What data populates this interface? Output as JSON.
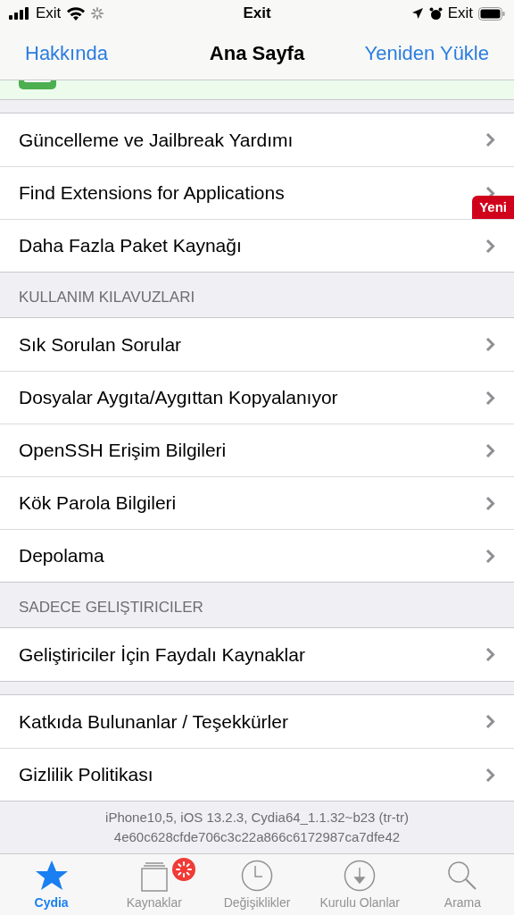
{
  "status_bar": {
    "left_carrier": "Exit",
    "center": "Exit",
    "right_carrier": "Exit"
  },
  "nav_bar": {
    "left_button": "Hakkında",
    "title": "Ana Sayfa",
    "right_button": "Yeniden Yükle"
  },
  "sections": [
    {
      "rows": [
        {
          "label": "Güncelleme ve Jailbreak Yardımı"
        },
        {
          "label": "Find Extensions for Applications",
          "badge": "Yeni"
        },
        {
          "label": "Daha Fazla Paket Kaynağı"
        }
      ]
    },
    {
      "header": "KULLANIM KILAVUZLARI",
      "rows": [
        {
          "label": "Sık Sorulan Sorular"
        },
        {
          "label": "Dosyalar Aygıta/Aygıttan Kopyalanıyor"
        },
        {
          "label": "OpenSSH Erişim Bilgileri"
        },
        {
          "label": "Kök Parola Bilgileri"
        },
        {
          "label": "Depolama"
        }
      ]
    },
    {
      "header": "SADECE GELIŞTIRICILER",
      "rows": [
        {
          "label": "Geliştiriciler İçin Faydalı Kaynaklar"
        }
      ]
    },
    {
      "rows": [
        {
          "label": "Katkıda Bulunanlar / Teşekkürler"
        },
        {
          "label": "Gizlilik Politikası"
        }
      ]
    }
  ],
  "footer": [
    "iPhone10,5, iOS 13.2.3, Cydia64_1.1.32~b23 (tr-tr)",
    "4e60c628cfde706c3c22a866c6172987ca7dfe42"
  ],
  "tab_bar": [
    {
      "kind": "star",
      "label": "Cydia",
      "selected": true
    },
    {
      "kind": "sources",
      "label": "Kaynaklar",
      "selected": false,
      "loading": true
    },
    {
      "kind": "clock",
      "label": "Değişiklikler",
      "selected": false
    },
    {
      "kind": "download",
      "label": "Kurulu Olanlar",
      "selected": false
    },
    {
      "kind": "search",
      "label": "Arama",
      "selected": false
    }
  ]
}
